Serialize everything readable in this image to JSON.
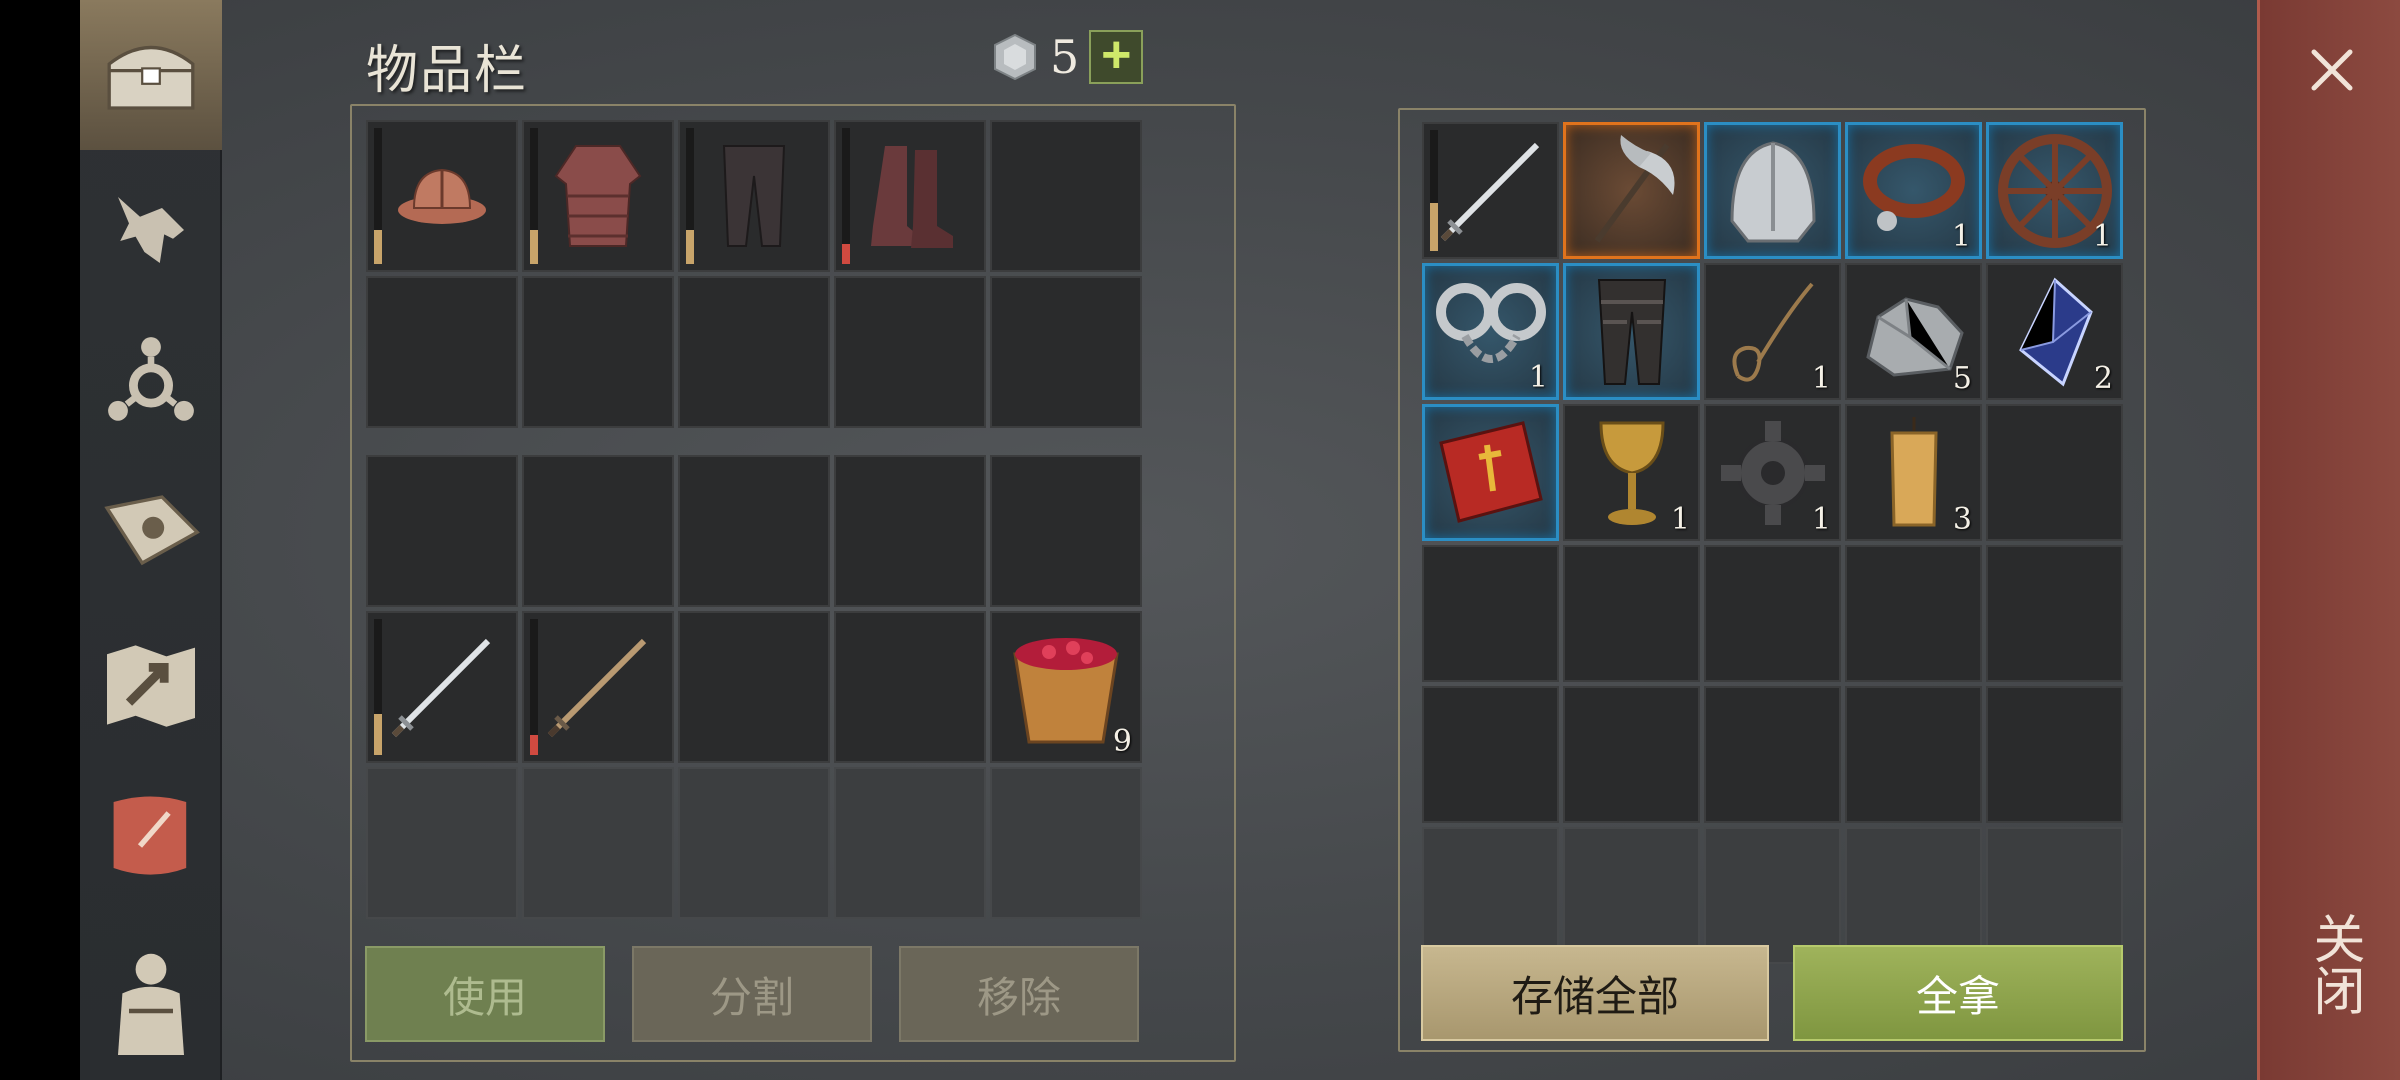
{
  "inventory": {
    "title": "物品栏",
    "currency_count": "5",
    "plus_label": "+"
  },
  "buttons": {
    "use": "使用",
    "split": "分割",
    "remove": "移除",
    "store_all": "存储全部",
    "take_all": "全拿"
  },
  "close_label": "关闭",
  "left_grid_top": [
    {
      "icon": "leather-hat-icon",
      "durability": 0.25,
      "dur_color": "#c8a46a"
    },
    {
      "icon": "chainmail-shirt-icon",
      "durability": 0.25,
      "dur_color": "#c8a46a"
    },
    {
      "icon": "leather-pants-icon",
      "durability": 0.25,
      "dur_color": "#c8a46a"
    },
    {
      "icon": "boots-icon",
      "durability": 0.15,
      "dur_color": "#d04a40"
    },
    {
      "icon": ""
    },
    {
      "icon": ""
    },
    {
      "icon": ""
    },
    {
      "icon": ""
    },
    {
      "icon": ""
    },
    {
      "icon": ""
    }
  ],
  "left_grid_bottom": [
    {
      "icon": ""
    },
    {
      "icon": ""
    },
    {
      "icon": ""
    },
    {
      "icon": ""
    },
    {
      "icon": ""
    },
    {
      "icon": "steel-sword-icon",
      "durability": 0.3,
      "dur_color": "#c8a46a"
    },
    {
      "icon": "bronze-sword-icon",
      "durability": 0.15,
      "dur_color": "#d04a40"
    },
    {
      "icon": ""
    },
    {
      "icon": ""
    },
    {
      "icon": "berry-bucket-icon",
      "count": "9"
    },
    {
      "icon": "",
      "faded": true
    },
    {
      "icon": "",
      "faded": true
    },
    {
      "icon": "",
      "faded": true
    },
    {
      "icon": "",
      "faded": true
    },
    {
      "icon": "",
      "faded": true
    }
  ],
  "right_grid": [
    {
      "icon": "steel-sword-icon",
      "durability": 0.4,
      "dur_color": "#c8a46a"
    },
    {
      "icon": "battle-axe-icon",
      "rarity": "orange"
    },
    {
      "icon": "steel-helmet-icon",
      "rarity": "blue"
    },
    {
      "icon": "leather-collar-icon",
      "rarity": "blue",
      "count": "1"
    },
    {
      "icon": "wooden-wheel-icon",
      "rarity": "blue",
      "count": "1"
    },
    {
      "icon": "shackles-icon",
      "rarity": "blue",
      "count": "1"
    },
    {
      "icon": "plated-pants-icon",
      "rarity": "blue"
    },
    {
      "icon": "rope-icon",
      "count": "1"
    },
    {
      "icon": "stone-icon",
      "count": "5"
    },
    {
      "icon": "crystal-icon",
      "count": "2"
    },
    {
      "icon": "red-book-icon",
      "rarity": "blue"
    },
    {
      "icon": "golden-goblet-icon",
      "count": "1"
    },
    {
      "icon": "gear-part-icon",
      "count": "1"
    },
    {
      "icon": "candle-icon",
      "count": "3"
    },
    {
      "icon": ""
    },
    {
      "icon": ""
    },
    {
      "icon": ""
    },
    {
      "icon": ""
    },
    {
      "icon": ""
    },
    {
      "icon": ""
    },
    {
      "icon": ""
    },
    {
      "icon": ""
    },
    {
      "icon": ""
    },
    {
      "icon": ""
    },
    {
      "icon": ""
    },
    {
      "icon": "",
      "faded": true
    },
    {
      "icon": "",
      "faded": true
    },
    {
      "icon": "",
      "faded": true
    },
    {
      "icon": "",
      "faded": true
    },
    {
      "icon": "",
      "faded": true
    }
  ],
  "nav": [
    {
      "icon": "chest-icon",
      "active": true
    },
    {
      "icon": "wolf-icon"
    },
    {
      "icon": "skill-tree-icon"
    },
    {
      "icon": "sun-book-icon"
    },
    {
      "icon": "map-icon"
    },
    {
      "icon": "scroll-icon"
    },
    {
      "icon": "character-icon"
    }
  ]
}
